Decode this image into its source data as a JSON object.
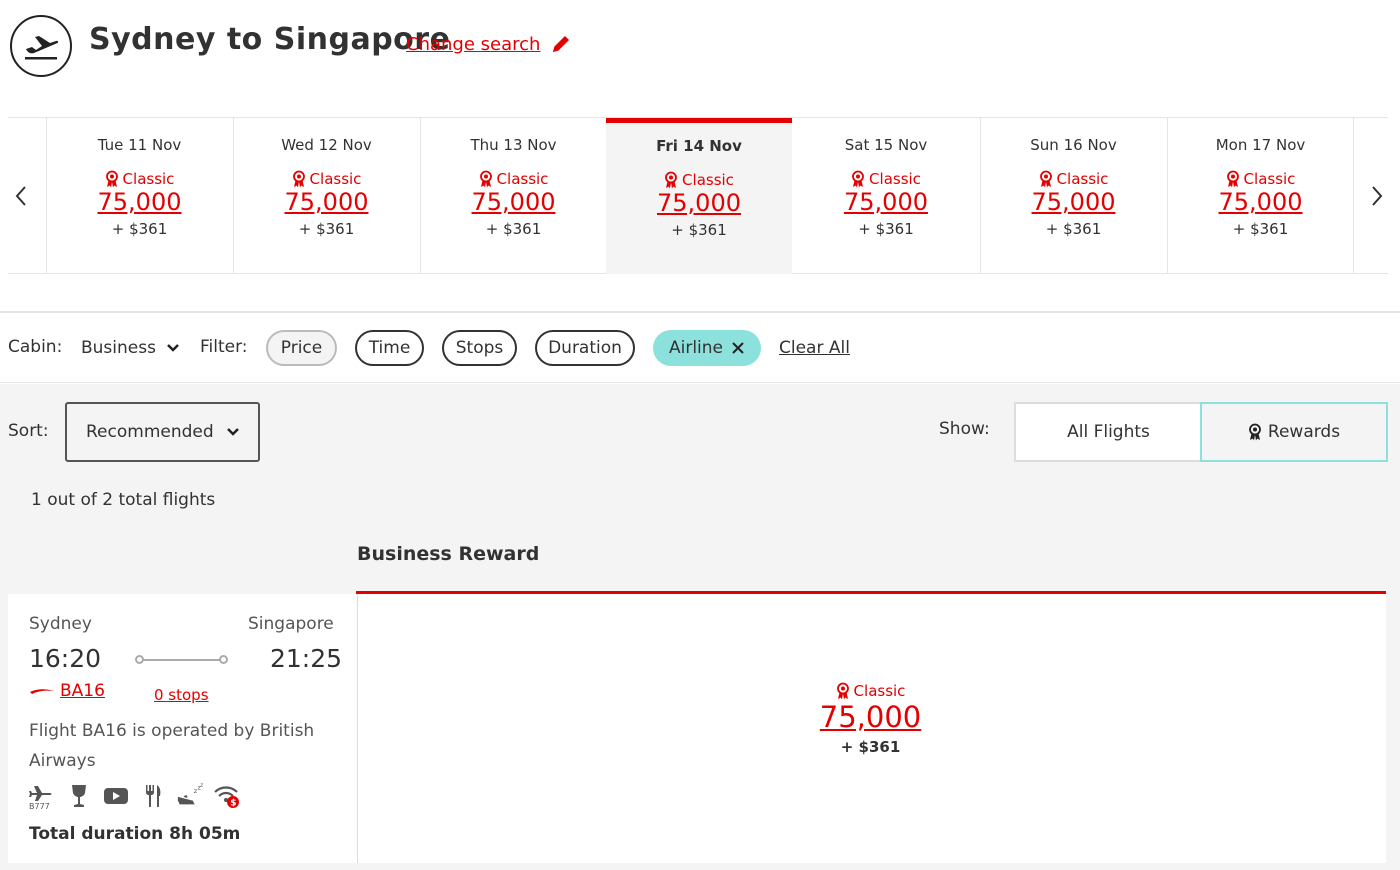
{
  "header": {
    "title": "Sydney to Singapore",
    "change_search": "Change search"
  },
  "carousel": {
    "dates": [
      {
        "label": "Tue 11 Nov",
        "award": "Classic",
        "points": "75,000",
        "tax": "+ $361",
        "selected": false
      },
      {
        "label": "Wed 12 Nov",
        "award": "Classic",
        "points": "75,000",
        "tax": "+ $361",
        "selected": false
      },
      {
        "label": "Thu 13 Nov",
        "award": "Classic",
        "points": "75,000",
        "tax": "+ $361",
        "selected": false
      },
      {
        "label": "Fri 14 Nov",
        "award": "Classic",
        "points": "75,000",
        "tax": "+ $361",
        "selected": true
      },
      {
        "label": "Sat 15 Nov",
        "award": "Classic",
        "points": "75,000",
        "tax": "+ $361",
        "selected": false
      },
      {
        "label": "Sun 16 Nov",
        "award": "Classic",
        "points": "75,000",
        "tax": "+ $361",
        "selected": false
      },
      {
        "label": "Mon 17 Nov",
        "award": "Classic",
        "points": "75,000",
        "tax": "+ $361",
        "selected": false
      }
    ]
  },
  "filters": {
    "cabin_label": "Cabin:",
    "cabin_value": "Business",
    "filter_label": "Filter:",
    "pills": [
      "Price",
      "Time",
      "Stops",
      "Duration",
      "Airline"
    ],
    "clear_all": "Clear All"
  },
  "results": {
    "sort_label": "Sort:",
    "sort_value": "Recommended",
    "show_label": "Show:",
    "show_all": "All Flights",
    "show_rewards": "Rewards",
    "count_text": "1 out of 2 total flights",
    "column_heading": "Business Reward"
  },
  "flight": {
    "origin": "Sydney",
    "destination": "Singapore",
    "depart_time": "16:20",
    "arrive_time": "21:25",
    "flight_number": "BA16",
    "stops": "0 stops",
    "operated_by": "Flight BA16 is operated by British Airways",
    "aircraft_code": "B777",
    "amenity_icons": [
      "aircraft-b777-icon",
      "wine-glass-icon",
      "entertainment-icon",
      "dining-icon",
      "flat-bed-icon",
      "paid-wifi-icon"
    ],
    "duration": "Total duration 8h 05m",
    "fare": {
      "award": "Classic",
      "points": "75,000",
      "tax": "+ $361"
    }
  },
  "colors": {
    "brand_red": "#e40000",
    "filter_active": "#8de1dd",
    "background_grey": "#f4f4f4"
  }
}
